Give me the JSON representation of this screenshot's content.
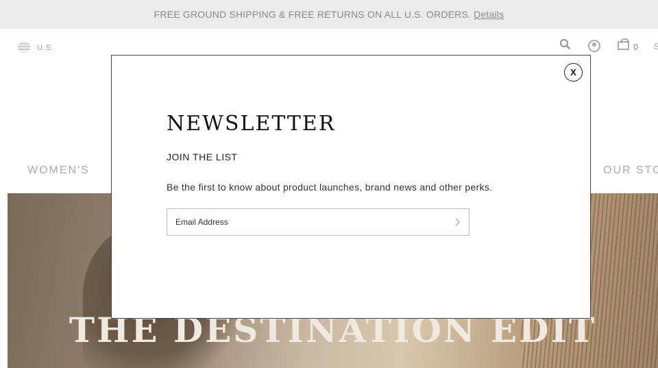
{
  "promo": {
    "text": "FREE GROUND SHIPPING & FREE RETURNS ON ALL U.S. ORDERS.",
    "link": "Details"
  },
  "header": {
    "country": "U.S.",
    "bag_count": "0",
    "extra": "S",
    "icons": [
      "flag-icon",
      "search-icon",
      "account-icon",
      "bag-icon"
    ]
  },
  "nav": {
    "womens": "WOMEN'S",
    "story": "OUR STO"
  },
  "hero": {
    "title": "THE DESTINATION EDIT"
  },
  "modal": {
    "title": "NEWSLETTER",
    "close": "X",
    "subtitle": "JOIN THE LIST",
    "description": "Be the first to know about product launches, brand news and other perks.",
    "email_placeholder": "Email Address"
  }
}
